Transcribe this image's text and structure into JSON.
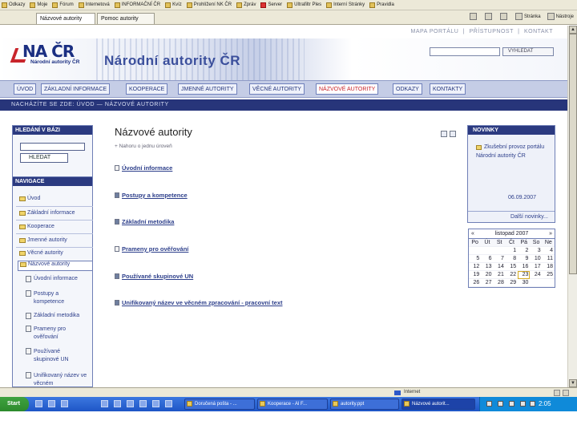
{
  "favorites": [
    "Odkazy",
    "Moje",
    "Fórum",
    "Internetová",
    "INFORMAČNÍ ČR",
    "Kvíz",
    "Prohlížení NK ČR",
    "Zpráv",
    "Server",
    "Ultrafiltr Ples",
    "Interní Stránky",
    "Pravidla"
  ],
  "tabs": [
    {
      "label": "Názvové autority"
    },
    {
      "label": "Pomoc autority"
    }
  ],
  "browser_tools": {
    "page_label": "Stránka",
    "tools_label": "Nástroje"
  },
  "header": {
    "toplinks": [
      "MAPA PORTÁLU",
      "PŘÍSTUPNOST",
      "KONTAKT"
    ],
    "logo_main": "NA ČR",
    "logo_sub": "Národní autority ČR",
    "site_title": "Národní autority ČR",
    "search_button": "VYHLEDAT"
  },
  "mainnav": [
    {
      "label": "ÚVOD"
    },
    {
      "label": "ZÁKLADNÍ INFORMACE"
    },
    {
      "label": "KOOPERACE"
    },
    {
      "label": "JMENNÉ AUTORITY"
    },
    {
      "label": "VĚCNÉ AUTORITY"
    },
    {
      "label": "NÁZVOVÉ AUTORITY",
      "active": true
    },
    {
      "label": "ODKAZY"
    },
    {
      "label": "KONTAKTY"
    }
  ],
  "breadcrumb": "NACHÁZÍTE SE ZDE: ÚVOD — NÁZVOVÉ AUTORITY",
  "left": {
    "search_title": "HLEDÁNÍ V BÁZI",
    "search_button": "HLEDAT",
    "nav_title": "NAVIGACE",
    "nav_items": [
      "Úvod",
      "Základní informace",
      "Kooperace",
      "Jmenné autority",
      "Věcné autority",
      "Názvové autority"
    ],
    "sub_items": [
      "Úvodní informace",
      "Postupy a kompetence",
      "Základní metodika",
      "Prameny pro ověřování",
      "Používané skupinové UN",
      "Unifikovaný název ve věcném"
    ]
  },
  "content": {
    "title": "Názvové autority",
    "subtitle": "+ Nahoru o jednu úroveň",
    "items": [
      "Úvodní informace",
      "Postupy a kompetence",
      "Základní metodika",
      "Prameny pro ověřování",
      "Používané skupinové UN",
      "Unifikovaný název ve věcném zpracování - pracovní text"
    ]
  },
  "news": {
    "title": "NOVINKY",
    "text": "Zkušební provoz portálu Národní autority ČR",
    "date": "06.09.2007",
    "more": "Další novinky..."
  },
  "calendar": {
    "prev": "«",
    "month": "listopad 2007",
    "next": "»",
    "dow": [
      "Po",
      "Út",
      "St",
      "Čt",
      "Pá",
      "So",
      "Ne"
    ],
    "rows": [
      [
        "",
        "",
        "",
        "1",
        "2",
        "3",
        "4"
      ],
      [
        "5",
        "6",
        "7",
        "8",
        "9",
        "10",
        "11"
      ],
      [
        "12",
        "13",
        "14",
        "15",
        "16",
        "17",
        "18"
      ],
      [
        "19",
        "20",
        "21",
        "22",
        "23",
        "24",
        "25"
      ],
      [
        "26",
        "27",
        "28",
        "29",
        "30",
        "",
        ""
      ]
    ],
    "today": "23"
  },
  "statusbar": {
    "zone": "Internet"
  },
  "taskbar": {
    "start": "Start",
    "tasks": [
      {
        "label": "Doručená pošta - ..."
      },
      {
        "label": "Kooperace - Al F..."
      },
      {
        "label": "autority.ppt"
      },
      {
        "label": "Názvové autorit...",
        "active": true
      }
    ],
    "clock": "2:05"
  }
}
